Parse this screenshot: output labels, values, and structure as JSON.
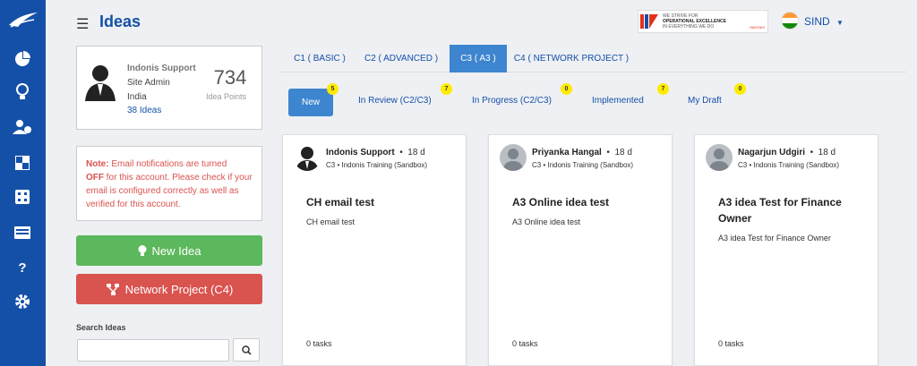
{
  "app": {
    "title": "Ideas"
  },
  "sidebar": {
    "icons": [
      "logo-icon",
      "dashboard-icon",
      "lightbulb-icon",
      "users-icon",
      "grid-icon",
      "calendar-icon",
      "list-icon",
      "help-icon",
      "settings-icon"
    ]
  },
  "header": {
    "banner_line1": "WE STRIVE FOR",
    "banner_line2": "OPERATIONAL EXCELLENCE",
    "banner_line3": "IN EVERYTHING WE DO",
    "banner_brand": "INDONIS",
    "user_name": "SIND"
  },
  "profile": {
    "name": "Indonis Support",
    "role": "Site Admin",
    "country": "India",
    "ideas_link": "38 Ideas",
    "points": "734",
    "points_label": "Idea Points"
  },
  "note": {
    "prefix": "Note:",
    "text1": "Email notifications are turned",
    "off": "OFF",
    "text2": "for this account. Please check if your email is configured correctly as well as verified for this account."
  },
  "buttons": {
    "new_idea": "New Idea",
    "network_project": "Network Project (C4)"
  },
  "search": {
    "label": "Search Ideas",
    "placeholder": ""
  },
  "tabs": [
    {
      "label": "C1 ( BASIC )"
    },
    {
      "label": "C2 ( ADVANCED )"
    },
    {
      "label": "C3 ( A3 )"
    },
    {
      "label": "C4 ( NETWORK PROJECT )"
    }
  ],
  "subtabs": [
    {
      "label": "New",
      "count": "5"
    },
    {
      "label": "In Review (C2/C3)",
      "count": "7"
    },
    {
      "label": "In Progress (C2/C3)",
      "count": "0"
    },
    {
      "label": "Implemented",
      "count": "7"
    },
    {
      "label": "My Draft",
      "count": "0"
    }
  ],
  "cards": [
    {
      "author": "Indonis Support",
      "age": "18 d",
      "meta": "C3  •  Indonis Training (Sandbox)",
      "title": "CH email test",
      "desc": "CH email test",
      "tasks": "0 tasks"
    },
    {
      "author": "Priyanka Hangal",
      "age": "18 d",
      "meta": "C3  •  Indonis Training (Sandbox)",
      "title": "A3 Online idea test",
      "desc": "A3 Online idea test",
      "tasks": "0 tasks"
    },
    {
      "author": "Nagarjun Udgiri",
      "age": "18 d",
      "meta": "C3  •  Indonis Training (Sandbox)",
      "title": "A3 idea Test for Finance Owner",
      "desc": "A3 idea Test for Finance Owner",
      "tasks": "0 tasks"
    }
  ],
  "colors": {
    "brand": "#1550a8",
    "success": "#5cb85c",
    "danger": "#d9534f",
    "tab_active": "#3e85cf",
    "badge": "#ffeb00"
  }
}
